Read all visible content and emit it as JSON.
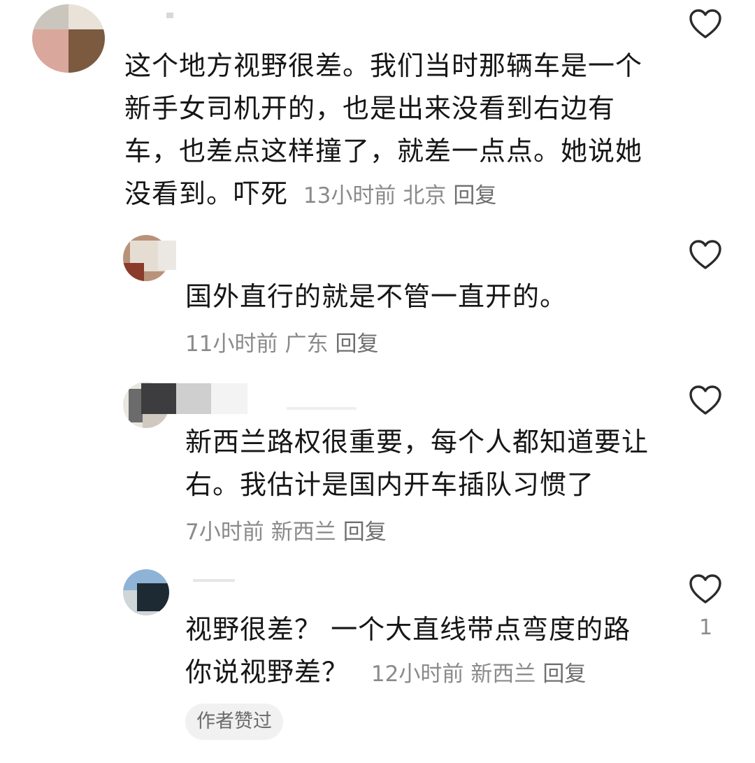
{
  "comments": [
    {
      "text_lines": [
        "这个地方视野很差。我们当时那辆车是一个",
        "新手女司机开的，也是出来没看到右边有",
        "车，也差点这样撞了，就差一点点。她说她",
        "没看到。吓死"
      ],
      "time": "13小时前",
      "location": "北京",
      "reply_label": "回复"
    },
    {
      "text_lines": [
        "国外直行的就是不管一直开的。"
      ],
      "time": "11小时前",
      "location": "广东",
      "reply_label": "回复"
    },
    {
      "text_lines": [
        "新西兰路权很重要，每个人都知道要让",
        "右。我估计是国内开车插队习惯了"
      ],
      "time": "7小时前",
      "location": "新西兰",
      "reply_label": "回复"
    },
    {
      "text_lines": [
        "视野很差？ 一个大直线带点弯度的路",
        "你说视野差？"
      ],
      "time": "12小时前",
      "location": "新西兰",
      "reply_label": "回复",
      "like_count": "1",
      "author_liked_badge": "作者赞过"
    }
  ],
  "icons": {
    "like": "heart-outline-icon"
  },
  "colors": {
    "text": "#161616",
    "meta": "#8a8a8a",
    "badge_bg": "#f1f1f1"
  }
}
